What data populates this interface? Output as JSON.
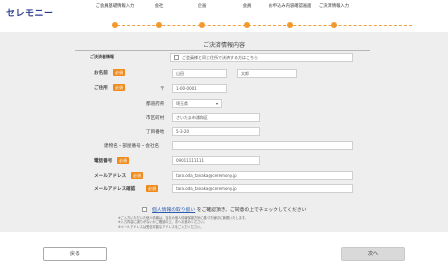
{
  "header": {
    "logo_text": "セレモニー",
    "steps": [
      {
        "label": "ご会員基礎情報入力"
      },
      {
        "label": "会社"
      },
      {
        "label": "企画"
      },
      {
        "label": "会員"
      },
      {
        "label": "お申込み内容確認画面"
      },
      {
        "label": "ご決済情報入力"
      }
    ]
  },
  "form": {
    "title": "ご決済情報内容",
    "same_as_member_label": "ご決済者情報",
    "same_as_member_check": "ご会員様と同じ住所で決済する方はこちら",
    "name": {
      "label": "お名前",
      "required": "必須",
      "last_value": "山田",
      "first_value": "太郎"
    },
    "address": {
      "label": "ご住所",
      "required": "必須",
      "postal_mark": "〒",
      "postal_value": "1-00-0001",
      "prefecture_label": "都道府県",
      "prefecture_value": "埼玉県",
      "city_label": "市区町村",
      "city_value": "さいたま市浦和区",
      "street_label": "丁目番地",
      "street_value": "5-3-20",
      "building_label": "建物名・部屋番号・会社名",
      "building_value": ""
    },
    "phone": {
      "label": "電話番号",
      "required": "必須",
      "value": "09011111111"
    },
    "email": {
      "label": "メールアドレス",
      "required": "必須",
      "value": "taro.oda_tanaka@ceremony.jp"
    },
    "email_confirm": {
      "label": "メールアドレス確認",
      "required": "必須",
      "value": "taro.oda_tanaka@ceremony.jp"
    }
  },
  "privacy": {
    "link_text": "個人情報の取り扱い",
    "suffix": "をご確認頂き、ご同意の上でチェックしてください"
  },
  "notes": [
    "※ご入力いただいた個人情報は、当社の個人情報保護方針に基づき適切に管理いたします。",
    "※入力内容に誤りがないかご確認の上、次へお進みください。",
    "※メールアドレスは受信可能なアドレスをご入力ください。"
  ],
  "footer": {
    "back_label": "戻る",
    "next_label": "次へ"
  }
}
